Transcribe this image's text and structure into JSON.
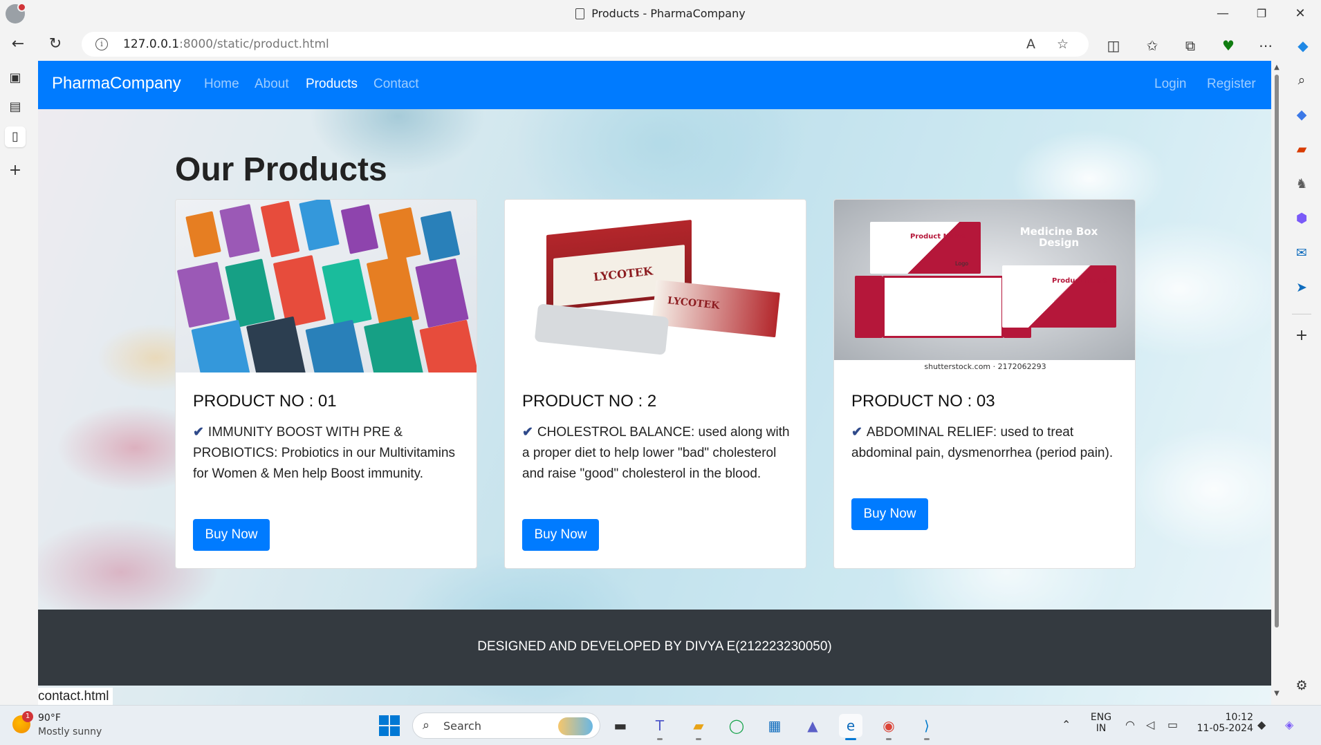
{
  "browser": {
    "window_title": "Products - PharmaCompany",
    "url_host": "127.0.0.1",
    "url_rest": ":8000/static/product.html",
    "minimize_glyph": "—",
    "restore_glyph": "❐",
    "close_glyph": "✕"
  },
  "site": {
    "brand": "PharmaCompany",
    "nav": {
      "home": "Home",
      "about": "About",
      "products": "Products",
      "contact": "Contact",
      "login": "Login",
      "register": "Register"
    },
    "heading": "Our Products",
    "colors": {
      "primary": "#007bff",
      "footer": "#343a40"
    },
    "products": [
      {
        "title": "PRODUCT NO : 01",
        "check": "✔",
        "description": "IMMUNITY BOOST WITH PRE & PROBIOTICS: Probiotics in our Multivitamins for Women & Men help Boost immunity.",
        "button": "Buy Now"
      },
      {
        "title": "PRODUCT NO : 2",
        "check": "✔",
        "description": "CHOLESTROL BALANCE: used along with a proper diet to help lower \"bad\" cholesterol and raise \"good\" cholesterol in the blood.",
        "button": "Buy Now",
        "box_brand": "LYCOTEK"
      },
      {
        "title": "PRODUCT NO : 03",
        "check": "✔",
        "description": "ABDOMINAL RELIEF: used to treat abdominal pain, dysmenorrhea (period pain).",
        "button": "Buy Now",
        "art_title": "Medicine Box Design",
        "art_label": "Product Name",
        "art_logo": "Logo",
        "watermark": "shutterstock.com · 2172062293"
      }
    ],
    "footer": "DESIGNED AND DEVELOPED BY DIVYA E(212223230050)",
    "status_url": "contact.html"
  },
  "taskbar": {
    "weather_temp": "90°F",
    "weather_desc": "Mostly sunny",
    "weather_badge": "1",
    "search_label": "Search",
    "lang_top": "ENG",
    "lang_bottom": "IN",
    "time": "10:12",
    "date": "11-05-2024"
  }
}
